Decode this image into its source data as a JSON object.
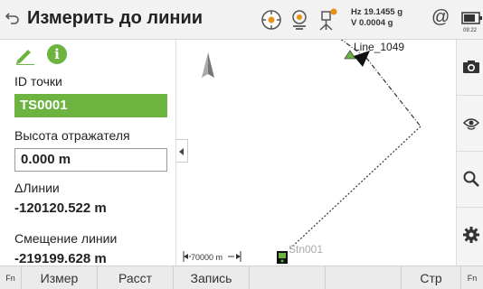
{
  "header": {
    "title": "Измерить до линии",
    "hz_line": "Hz 19.1455 g",
    "v_line": "V  0.0004 g",
    "at_symbol": "@",
    "time": "09:22"
  },
  "panel": {
    "point_id_label": "ID точки",
    "point_id_value": "TS0001",
    "reflector_height_label": "Высота отражателя",
    "reflector_height_value": "0.000 m",
    "delta_line_label": "ΔЛинии",
    "delta_line_value": "-120120.522 m",
    "line_offset_label": "Смещение линии",
    "line_offset_value": "-219199.628 m"
  },
  "map": {
    "line_label": "Line_1049",
    "instrument_label": "Stn001",
    "scale_label": "70000 m"
  },
  "right_bar": {
    "icons": [
      "camera-icon",
      "eye-refresh-icon",
      "search-icon",
      "gear-icon"
    ]
  },
  "softkeys": {
    "fn_left": "Fn",
    "measure": "Измер",
    "distance": "Расст",
    "record": "Запись",
    "page": "Стр",
    "fn_right": "Fn"
  },
  "colors": {
    "accent_green": "#6cb33f",
    "status_orange": "#e8901a"
  }
}
